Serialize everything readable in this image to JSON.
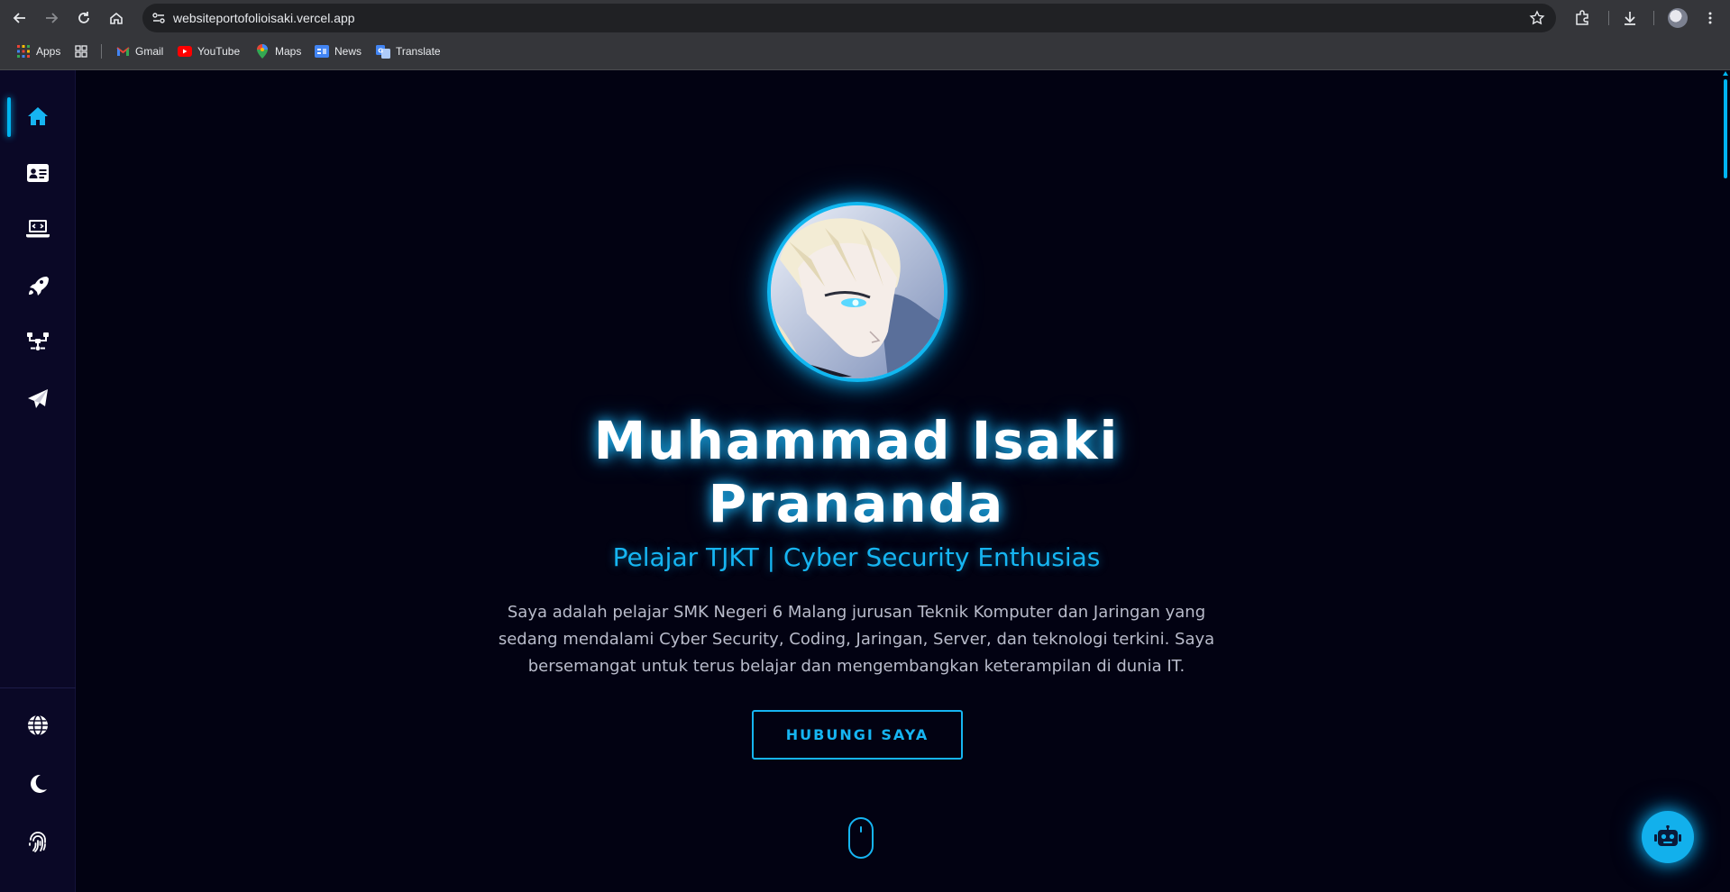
{
  "browser": {
    "url": "websiteportofolioisaki.vercel.app",
    "bookmarks": [
      {
        "label": "Apps",
        "icon": "apps-grid-icon"
      },
      {
        "label": "",
        "icon": "tab-groups-icon"
      },
      {
        "label": "Gmail",
        "icon": "gmail-icon"
      },
      {
        "label": "YouTube",
        "icon": "youtube-icon"
      },
      {
        "label": "Maps",
        "icon": "maps-icon"
      },
      {
        "label": "News",
        "icon": "news-icon"
      },
      {
        "label": "Translate",
        "icon": "translate-icon"
      }
    ]
  },
  "sidebar": {
    "items": [
      {
        "icon": "home-icon",
        "active": true
      },
      {
        "icon": "id-card-icon",
        "active": false
      },
      {
        "icon": "laptop-code-icon",
        "active": false
      },
      {
        "icon": "rocket-icon",
        "active": false
      },
      {
        "icon": "network-icon",
        "active": false
      },
      {
        "icon": "paper-plane-icon",
        "active": false
      }
    ],
    "bottom_items": [
      {
        "icon": "globe-icon"
      },
      {
        "icon": "moon-icon"
      },
      {
        "icon": "fingerprint-icon"
      }
    ]
  },
  "hero": {
    "name_line1": "Muhammad Isaki",
    "name_line2": "Pranandа",
    "tagline": "Pelajar TJKT | Cyber Security Enthusias",
    "description": "Saya adalah pelajar SMK Negeri 6 Malang jurusan Teknik Komputer dan Jaringan yang sedang mendalami Cyber Security, Coding, Jaringan, Server, dan teknologi terkini. Saya bersemangat untuk terus belajar dan mengembangkan keterampilan di dunia IT.",
    "cta_label": "HUBUNGI SAYA"
  },
  "colors": {
    "accent": "#16b5f2",
    "background": "#020212",
    "sidebar": "#0a0826"
  }
}
